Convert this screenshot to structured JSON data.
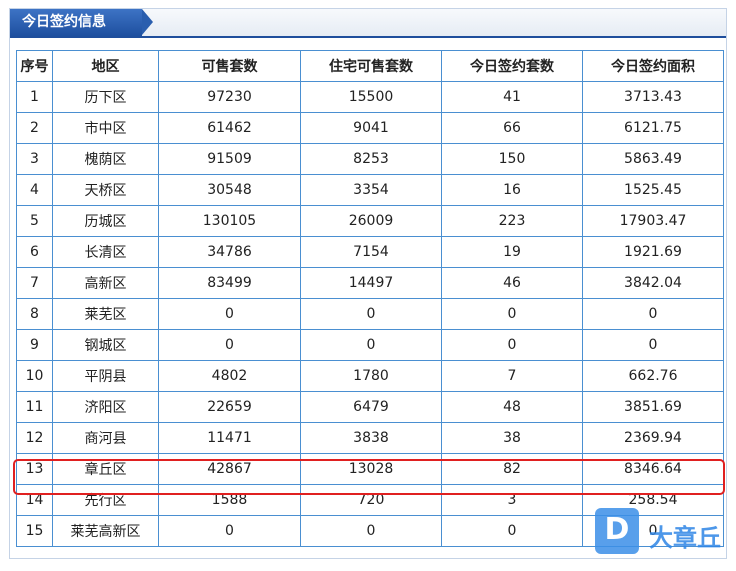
{
  "panel": {
    "title": "今日签约信息"
  },
  "table": {
    "headers": [
      "序号",
      "地区",
      "可售套数",
      "住宅可售套数",
      "今日签约套数",
      "今日签约面积"
    ],
    "rows": [
      [
        "1",
        "历下区",
        "97230",
        "15500",
        "41",
        "3713.43"
      ],
      [
        "2",
        "市中区",
        "61462",
        "9041",
        "66",
        "6121.75"
      ],
      [
        "3",
        "槐荫区",
        "91509",
        "8253",
        "150",
        "5863.49"
      ],
      [
        "4",
        "天桥区",
        "30548",
        "3354",
        "16",
        "1525.45"
      ],
      [
        "5",
        "历城区",
        "130105",
        "26009",
        "223",
        "17903.47"
      ],
      [
        "6",
        "长清区",
        "34786",
        "7154",
        "19",
        "1921.69"
      ],
      [
        "7",
        "高新区",
        "83499",
        "14497",
        "46",
        "3842.04"
      ],
      [
        "8",
        "莱芜区",
        "0",
        "0",
        "0",
        "0"
      ],
      [
        "9",
        "钢城区",
        "0",
        "0",
        "0",
        "0"
      ],
      [
        "10",
        "平阴县",
        "4802",
        "1780",
        "7",
        "662.76"
      ],
      [
        "11",
        "济阳区",
        "22659",
        "6479",
        "48",
        "3851.69"
      ],
      [
        "12",
        "商河县",
        "11471",
        "3838",
        "38",
        "2369.94"
      ],
      [
        "13",
        "章丘区",
        "42867",
        "13028",
        "82",
        "8346.64"
      ],
      [
        "14",
        "先行区",
        "1588",
        "720",
        "3",
        "258.54"
      ],
      [
        "15",
        "莱芜高新区",
        "0",
        "0",
        "0",
        "0"
      ]
    ],
    "highlighted_row": "13"
  },
  "watermark": {
    "logo_letter": "D",
    "text": "大章丘"
  },
  "colors": {
    "header_blue": "#1f4e9c",
    "border_blue": "#4a8fd1",
    "highlight_red": "#e02020"
  }
}
